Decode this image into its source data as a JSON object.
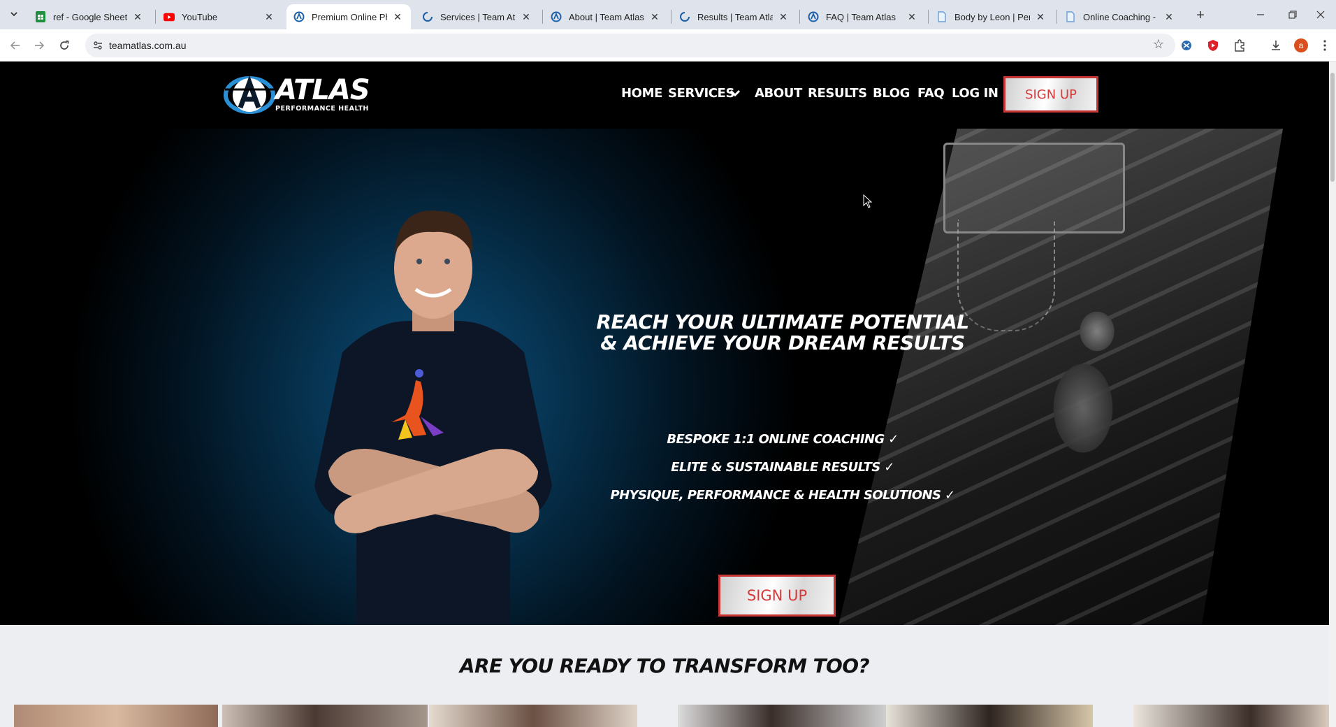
{
  "browser": {
    "tabs": [
      {
        "title": "ref - Google Sheets",
        "favicon": "sheets-icon",
        "active": false
      },
      {
        "title": "YouTube",
        "favicon": "youtube-icon",
        "active": false
      },
      {
        "title": "Premium Online Phys",
        "favicon": "atlas-icon",
        "active": true
      },
      {
        "title": "Services | Team Atlas",
        "favicon": "atlas-icon",
        "active": false
      },
      {
        "title": "About | Team Atlas",
        "favicon": "atlas-icon",
        "active": false
      },
      {
        "title": "Results | Team Atlas",
        "favicon": "atlas-icon",
        "active": false
      },
      {
        "title": "FAQ | Team Atlas",
        "favicon": "atlas-icon",
        "active": false
      },
      {
        "title": "Body by Leon | Perso",
        "favicon": "page-icon",
        "active": false
      },
      {
        "title": "Online Coaching - Bo",
        "favicon": "page-icon",
        "active": false
      }
    ],
    "url": "teamatlas.com.au",
    "profile_initial": "a"
  },
  "site": {
    "logo": {
      "word": "ATLAS",
      "tagline": "PERFORMANCE HEALTH"
    },
    "nav": [
      {
        "label": "HOME"
      },
      {
        "label": "SERVICES"
      },
      {
        "label": "ABOUT"
      },
      {
        "label": "RESULTS"
      },
      {
        "label": "BLOG"
      },
      {
        "label": "FAQ"
      },
      {
        "label": "LOG IN"
      }
    ],
    "header_signup": "SIGN UP",
    "hero": {
      "title_line1": "REACH YOUR ULTIMATE POTENTIAL",
      "title_line2": "& ACHIEVE YOUR DREAM RESULTS",
      "benefits": [
        "BESPOKE 1:1 ONLINE COACHING ✓",
        "ELITE & SUSTAINABLE RESULTS ✓",
        "PHYSIQUE, PERFORMANCE & HEALTH SOLUTIONS ✓"
      ],
      "signup": "SIGN UP"
    },
    "transform_heading": "ARE YOU READY TO TRANSFORM TOO?"
  },
  "colors": {
    "accent_red": "#d63a3a",
    "hero_blue": "#0d4e7a",
    "section_bg": "#eceef2"
  }
}
